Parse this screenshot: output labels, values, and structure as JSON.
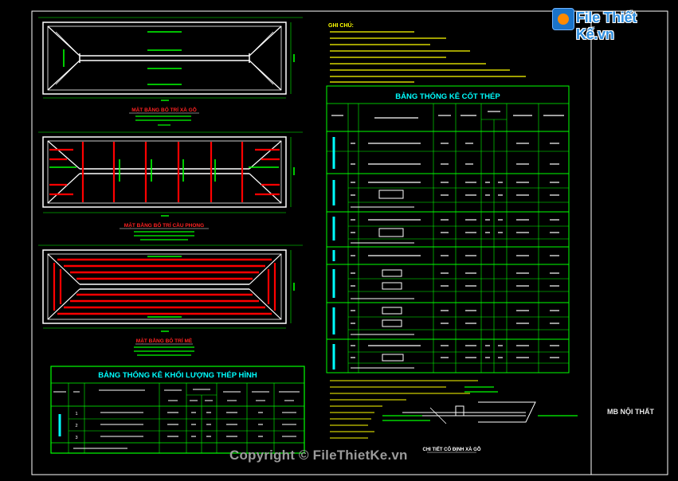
{
  "colors": {
    "background": "#000000",
    "frame": "#ffffff",
    "accent_cyan": "#00ffff",
    "accent_yellow": "#ffff00",
    "accent_green": "#00ff00",
    "accent_red": "#ff0000",
    "accent_blue": "#3a7bff",
    "text_white": "#ffffff"
  },
  "watermark": {
    "logo_text": "File Thiết Kế.vn",
    "copyright": "Copyright © FileThietKe.vn"
  },
  "title_block": {
    "sheet_name": "MB NỘI THẤT"
  },
  "plans": {
    "plan1_title": "MẶT BẰNG BỐ TRÍ XÀ GỖ",
    "plan2_title": "MẶT BẰNG BỐ TRÍ CẦU PHONG",
    "plan3_title": "MẶT BẰNG BỐ TRÍ MÈ"
  },
  "notes": {
    "heading": "GHI CHÚ:"
  },
  "rebar_table": {
    "title": "BẢNG THỐNG KÊ CỐT THÉP",
    "headers": [
      "TÊN CK",
      "STT",
      "HÌNH DẠNG, KÍCH THƯỚC",
      "ĐƯỜNG KÍNH",
      "CHIỀU DÀI THANH",
      "SỐ LƯỢNG",
      "TỔNG CHIỀU DÀI",
      "TRỌNG LƯỢNG"
    ]
  },
  "steel_table": {
    "title": "BẢNG THỐNG KÊ KHỐI LƯỢNG THÉP HÌNH",
    "headers": [
      "CẤU KIỆN",
      "STT",
      "QUY CÁCH - KÍCH THƯỚC",
      "CHIỀU DÀI",
      "SỐ LƯỢNG",
      "TỔNG CHIỀU DÀI",
      "TRỌNG LƯỢNG ĐƠN VỊ",
      "KHỐI LƯỢNG"
    ],
    "row_numbers": [
      "1",
      "2",
      "3"
    ]
  },
  "detail": {
    "title": "CHI TIẾT CỐ ĐỊNH XÀ GỖ"
  }
}
